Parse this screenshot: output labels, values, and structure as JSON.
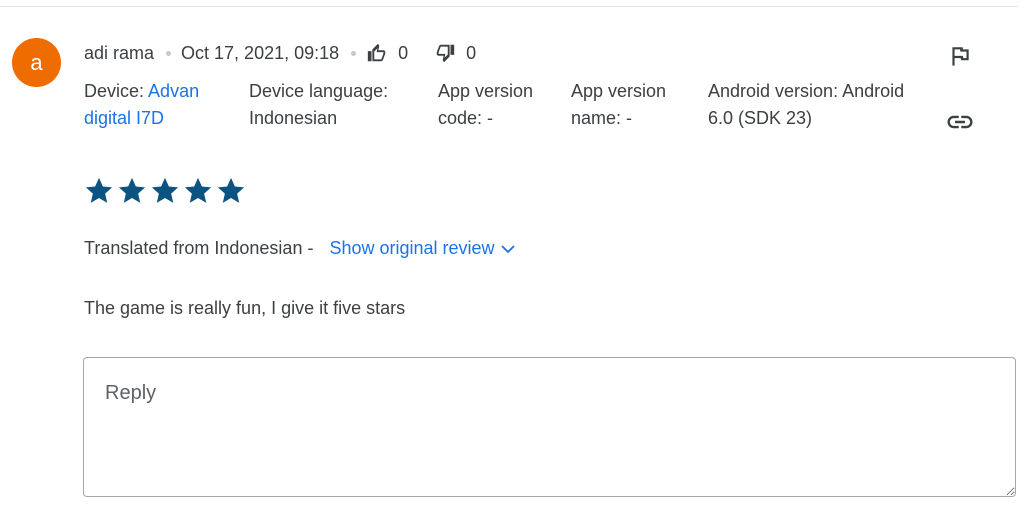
{
  "avatar": {
    "letter": "a",
    "color": "#ef6c00"
  },
  "review": {
    "author": "adi rama",
    "date": "Oct 17, 2021, 09:18",
    "thumbs_up_count": "0",
    "thumbs_down_count": "0",
    "device_label": "Device:",
    "device_value_line1": "Advan",
    "device_value_line2": "digital I7D",
    "language_line1": "Device language:",
    "language_line2": "Indonesian",
    "app_code_line1": "App version",
    "app_code_line2": "code: -",
    "app_name_line1": "App version",
    "app_name_line2": "name: -",
    "android_line1": "Android version: Android",
    "android_line2": "6.0 (SDK 23)",
    "rating": 5,
    "translated_label": "Translated from Indonesian -",
    "show_original_label": "Show original review",
    "text": "The game is really fun, I give it five stars"
  },
  "reply": {
    "placeholder": "Reply"
  },
  "colors": {
    "star": "#0b5380",
    "link": "#1a73e8",
    "icon": "#3c4043"
  },
  "icons": [
    "thumbs-up-icon",
    "thumbs-down-icon",
    "flag-icon",
    "link-icon",
    "star-icon",
    "chevron-down-icon"
  ]
}
